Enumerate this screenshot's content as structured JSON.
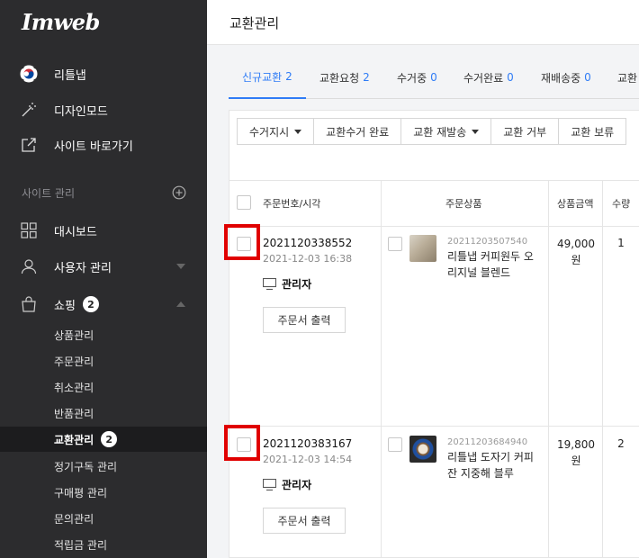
{
  "sidebar": {
    "logo": "Imweb",
    "top_items": [
      {
        "label": "리틀냅",
        "icon": "korea-flag-icon"
      },
      {
        "label": "디자인모드",
        "icon": "magic-wand-icon"
      },
      {
        "label": "사이트 바로가기",
        "icon": "external-link-icon"
      }
    ],
    "section_label": "사이트 관리",
    "section_action_icon": "plus-circle-icon",
    "main_items": [
      {
        "label": "대시보드",
        "icon": "grid-icon"
      },
      {
        "label": "사용자 관리",
        "icon": "user-icon"
      },
      {
        "label": "쇼핑",
        "icon": "shopping-bag-icon",
        "badge": "2"
      }
    ],
    "sub_items": [
      {
        "label": "상품관리"
      },
      {
        "label": "주문관리"
      },
      {
        "label": "취소관리"
      },
      {
        "label": "반품관리"
      },
      {
        "label": "교환관리",
        "badge": "2",
        "active": true
      },
      {
        "label": "정기구독 관리"
      },
      {
        "label": "구매평 관리"
      },
      {
        "label": "문의관리"
      },
      {
        "label": "적립금 관리"
      }
    ]
  },
  "header": {
    "title": "교환관리"
  },
  "tabs": [
    {
      "label": "신규교환",
      "count": "2",
      "active": true
    },
    {
      "label": "교환요청",
      "count": "2"
    },
    {
      "label": "수거중",
      "count": "0"
    },
    {
      "label": "수거완료",
      "count": "0"
    },
    {
      "label": "재배송중",
      "count": "0"
    },
    {
      "label": "교환"
    }
  ],
  "toolbar": {
    "buttons": [
      {
        "label": "수거지시",
        "dropdown": true
      },
      {
        "label": "교환수거 완료"
      },
      {
        "label": "교환 재발송",
        "dropdown": true
      },
      {
        "label": "교환 거부"
      },
      {
        "label": "교환 보류"
      }
    ]
  },
  "table": {
    "headers": {
      "order": "주문번호/시각",
      "product": "주문상품",
      "amount": "상품금액",
      "qty": "수량"
    },
    "rows": [
      {
        "order_no": "2021120338552",
        "date": "2021-12-03 16:38",
        "channel": "관리자",
        "print_label": "주문서 출력",
        "product_code": "20211203507540",
        "product_name": "리틀냅 커피원두 오리지널 블렌드",
        "price": "49,000",
        "currency": "원",
        "qty": "1"
      },
      {
        "order_no": "2021120383167",
        "date": "2021-12-03 14:54",
        "channel": "관리자",
        "print_label": "주문서 출력",
        "product_code": "20211203684940",
        "product_name": "리틀냅 도자기 커피잔 지중해 블루",
        "price": "19,800",
        "currency": "원",
        "qty": "2"
      }
    ]
  }
}
